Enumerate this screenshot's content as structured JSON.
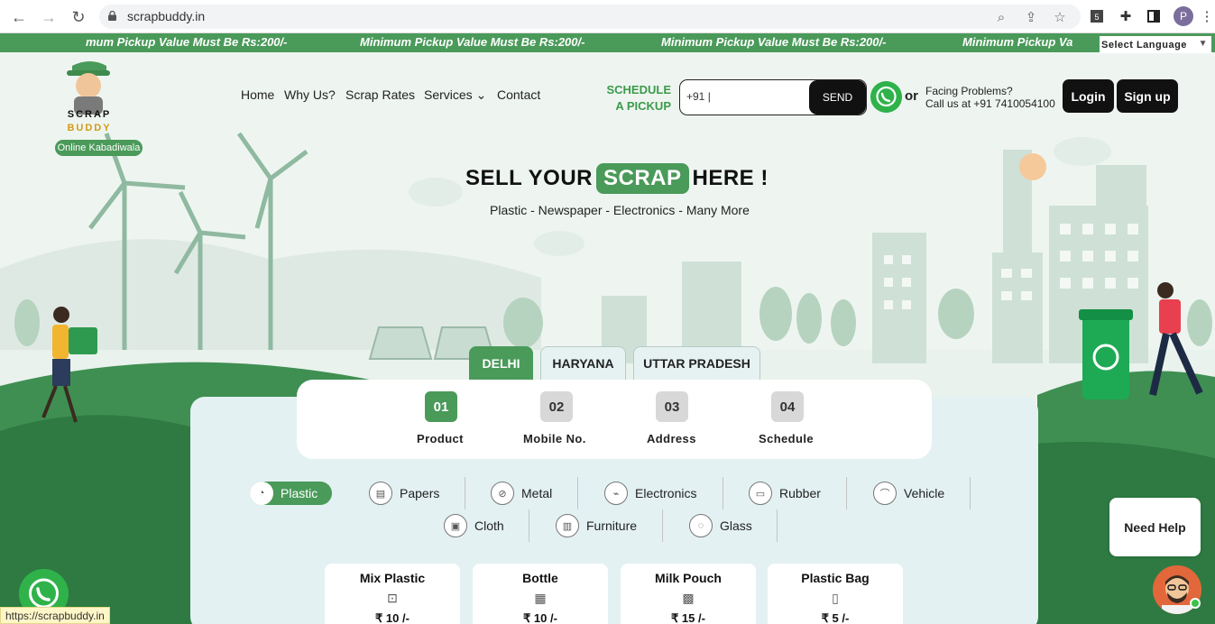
{
  "browser": {
    "url": "scrapbuddy.in",
    "profile_initial": "P",
    "status_url": "https://scrapbuddy.in"
  },
  "marquee": {
    "items": [
      "mum Pickup Value Must Be Rs:200/-",
      "Minimum Pickup Value Must Be Rs:200/-",
      "Minimum Pickup Value Must Be Rs:200/-",
      "Minimum Pickup Va"
    ]
  },
  "language": {
    "label": "Select Language",
    "arrow": "▼"
  },
  "logo": {
    "word1": "SCRAP",
    "word2": "BUDDY",
    "badge": "Online Kabadiwala"
  },
  "nav": {
    "home": "Home",
    "why": "Why Us?",
    "rates": "Scrap Rates",
    "services": "Services",
    "contact": "Contact"
  },
  "schedule": {
    "line1": "SCHEDULE",
    "line2": "A PICKUP",
    "phone_value": "+91 |",
    "send": "SEND"
  },
  "contact": {
    "or": "or",
    "line1": "Facing Problems?",
    "line2": "Call us at +91 7410054100"
  },
  "auth": {
    "login": "Login",
    "signup": "Sign up"
  },
  "hero": {
    "sell": "SELL YOUR",
    "scrap": "SCRAP",
    "here": "HERE !",
    "sub": "Plastic - Newspaper - Electronics - Many More"
  },
  "states": [
    "DELHI",
    "HARYANA",
    "UTTAR PRADESH"
  ],
  "steps": [
    {
      "num": "01",
      "label": "Product"
    },
    {
      "num": "02",
      "label": "Mobile No."
    },
    {
      "num": "03",
      "label": "Address"
    },
    {
      "num": "04",
      "label": "Schedule"
    }
  ],
  "categories": [
    "Plastic",
    "Papers",
    "Metal",
    "Electronics",
    "Rubber",
    "Vehicle",
    "Cloth",
    "Furniture",
    "Glass"
  ],
  "products": [
    {
      "name": "Mix Plastic",
      "price": "₹ 10 /-"
    },
    {
      "name": "Bottle",
      "price": "₹ 10 /-"
    },
    {
      "name": "Milk Pouch",
      "price": "₹ 15 /-"
    },
    {
      "name": "Plastic Bag",
      "price": "₹ 5 /-"
    }
  ],
  "help": {
    "label": "Need Help"
  },
  "colors": {
    "brand": "#4a9a5a",
    "dark": "#111111",
    "panel": "#e3f1f3"
  }
}
